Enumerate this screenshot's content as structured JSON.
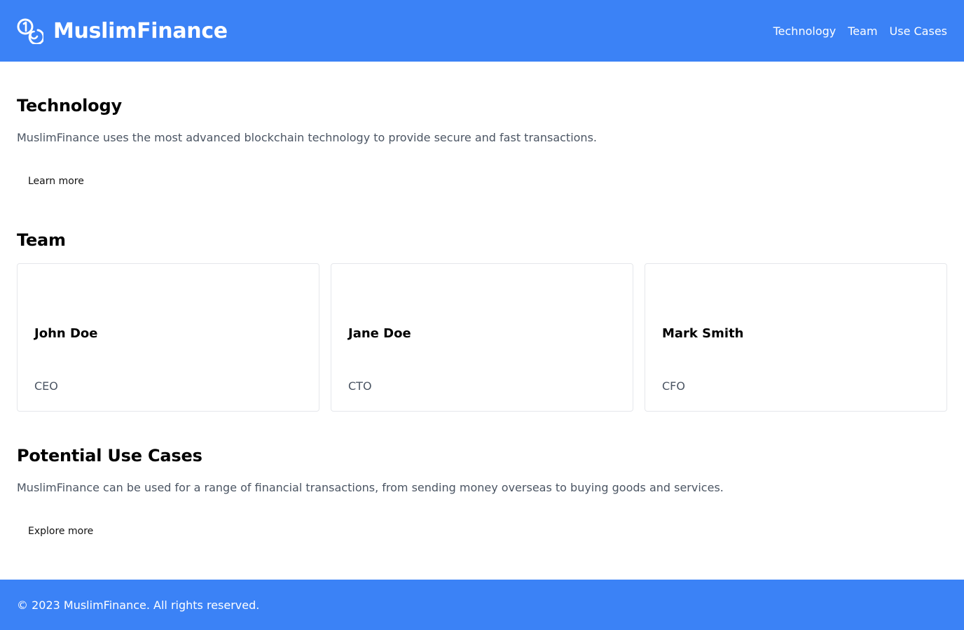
{
  "header": {
    "brand_name": "MuslimFinance",
    "brand_icon": "coins-icon",
    "nav": [
      {
        "label": "Technology"
      },
      {
        "label": "Team"
      },
      {
        "label": "Use Cases"
      }
    ]
  },
  "technology": {
    "title": "Technology",
    "text": "MuslimFinance uses the most advanced blockchain technology to provide secure and fast transactions.",
    "button_label": "Learn more"
  },
  "team": {
    "title": "Team",
    "members": [
      {
        "name": "John Doe",
        "role": "CEO"
      },
      {
        "name": "Jane Doe",
        "role": "CTO"
      },
      {
        "name": "Mark Smith",
        "role": "CFO"
      }
    ]
  },
  "use_cases": {
    "title": "Potential Use Cases",
    "text": "MuslimFinance can be used for a range of financial transactions, from sending money overseas to buying goods and services.",
    "button_label": "Explore more"
  },
  "footer": {
    "text": "© 2023 MuslimFinance. All rights reserved."
  },
  "colors": {
    "brand": "#3b82f6",
    "muted_text": "#4b5563",
    "card_border": "#e5e7eb"
  }
}
